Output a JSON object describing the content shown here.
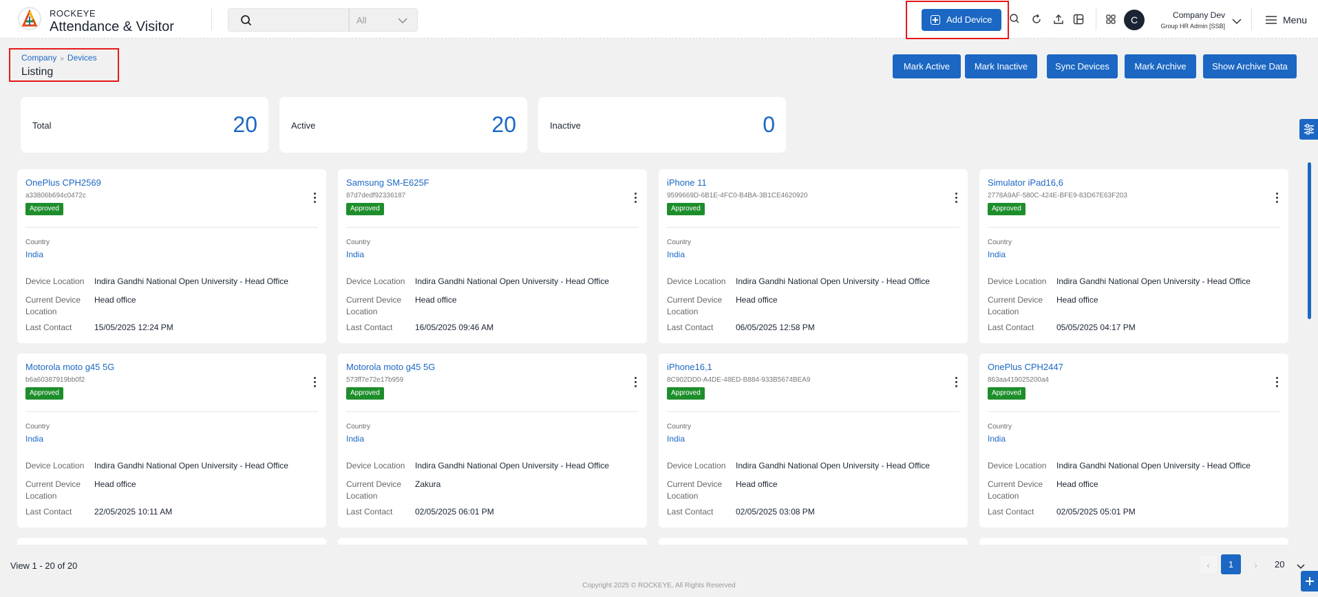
{
  "brand": {
    "small": "ROCKEYE",
    "big": "Attendance & Visitor"
  },
  "search": {
    "placeholder": "",
    "scope": "All"
  },
  "header": {
    "add_device": "Add Device",
    "user_initial": "C",
    "user_name": "Company Dev",
    "user_role": "Group HR Admin [SSB]",
    "menu": "Menu"
  },
  "breadcrumb": {
    "company": "Company",
    "devices": "Devices",
    "title": "Listing"
  },
  "actions": {
    "mark_active": "Mark Active",
    "mark_inactive": "Mark Inactive",
    "sync_devices": "Sync Devices",
    "mark_archive": "Mark Archive",
    "show_archive": "Show Archive Data"
  },
  "stats": [
    {
      "label": "Total",
      "value": "20"
    },
    {
      "label": "Active",
      "value": "20"
    },
    {
      "label": "Inactive",
      "value": "0"
    }
  ],
  "card_labels": {
    "country": "Country",
    "device_location": "Device Location",
    "current_location_1": "Current Device",
    "current_location_2": "Location",
    "last_contact": "Last Contact"
  },
  "devices": [
    {
      "name": "OnePlus CPH2569",
      "id": "a33806b694c0472c",
      "status": "Approved",
      "country": "India",
      "device_location": "Indira Gandhi National Open University - Head Office",
      "current_location": "Head office",
      "last_contact": "15/05/2025 12:24 PM"
    },
    {
      "name": "Samsung SM-E625F",
      "id": "87d7dedf92336187",
      "status": "Approved",
      "country": "India",
      "device_location": "Indira Gandhi National Open University - Head Office",
      "current_location": "Head office",
      "last_contact": "16/05/2025 09:46 AM"
    },
    {
      "name": "iPhone 11",
      "id": "9599669D-6B1E-4FC0-B4BA-3B1CE4620920",
      "status": "Approved",
      "country": "India",
      "device_location": "Indira Gandhi National Open University - Head Office",
      "current_location": "Head office",
      "last_contact": "06/05/2025 12:58 PM"
    },
    {
      "name": "Simulator iPad16,6",
      "id": "2778A9AF-580C-424E-BFE9-83D67E63F203",
      "status": "Approved",
      "country": "India",
      "device_location": "Indira Gandhi National Open University - Head Office",
      "current_location": "Head office",
      "last_contact": "05/05/2025 04:17 PM"
    },
    {
      "name": "Motorola moto g45 5G",
      "id": "b6a60387919bb0f2",
      "status": "Approved",
      "country": "India",
      "device_location": "Indira Gandhi National Open University - Head Office",
      "current_location": "Head office",
      "last_contact": "22/05/2025 10:11 AM"
    },
    {
      "name": "Motorola moto g45 5G",
      "id": "573ff7e72e17b959",
      "status": "Approved",
      "country": "India",
      "device_location": "Indira Gandhi National Open University - Head Office",
      "current_location": "Zakura",
      "last_contact": "02/05/2025 06:01 PM"
    },
    {
      "name": "iPhone16,1",
      "id": "8C902DD0-A4DE-48ED-B884-933B5674BEA9",
      "status": "Approved",
      "country": "India",
      "device_location": "Indira Gandhi National Open University - Head Office",
      "current_location": "Head office",
      "last_contact": "02/05/2025 03:08 PM"
    },
    {
      "name": "OnePlus CPH2447",
      "id": "863aa419025200a4",
      "status": "Approved",
      "country": "India",
      "device_location": "Indira Gandhi National Open University - Head Office",
      "current_location": "Head office",
      "last_contact": "02/05/2025 05:01 PM"
    }
  ],
  "pagination": {
    "view": "View 1 - 20 of 20",
    "current_page": "1",
    "per_page": "20",
    "prev": "‹",
    "next": "›"
  },
  "footer": {
    "copyright": "Copyright 2025 © ROCKEYE. All Rights Reserved"
  },
  "colors": {
    "primary": "#1b67c3",
    "approved": "#1e8e2c",
    "highlight": "#e61717"
  }
}
